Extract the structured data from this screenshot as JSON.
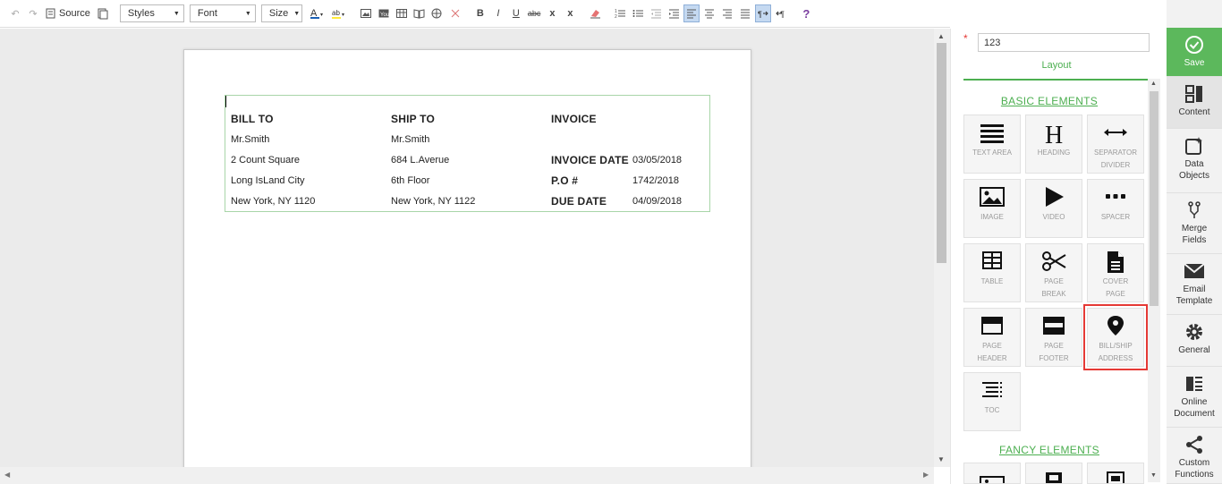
{
  "toolbar": {
    "source_label": "Source",
    "styles_label": "Styles",
    "font_label": "Font",
    "size_label": "Size",
    "bold": "B",
    "italic": "I",
    "underline": "U",
    "strike": "abc",
    "subscript": "x",
    "superscript": "x",
    "help": "?"
  },
  "invoice": {
    "bill_to": "BILL TO",
    "ship_to": "SHIP TO",
    "invoice": "INVOICE",
    "bill_name": "Mr.Smith",
    "ship_name": "Mr.Smith",
    "bill_addr1": "2 Count Square",
    "ship_addr1": "684 L.Averue",
    "invoice_date_label": "INVOICE DATE",
    "invoice_date": "03/05/2018",
    "bill_addr2": "Long IsLand City",
    "ship_addr2": "6th Floor",
    "po_label": "P.O #",
    "po_value": "1742/2018",
    "bill_addr3": "New York, NY 1120",
    "ship_addr3": "New York, NY 1122",
    "due_date_label": "DUE DATE",
    "due_date": "04/09/2018"
  },
  "panel": {
    "name_value": "123",
    "required_mark": "*",
    "tab_label": "Layout",
    "basic_title": "BASIC ELEMENTS",
    "fancy_title": "FANCY ELEMENTS",
    "tiles": [
      {
        "label1": "TEXT AREA",
        "label2": "",
        "icon": "text-area-icon"
      },
      {
        "label1": "HEADING",
        "label2": "",
        "icon": "heading-icon"
      },
      {
        "label1": "SEPARATOR",
        "label2": "DIVIDER",
        "icon": "separator-icon"
      },
      {
        "label1": "IMAGE",
        "label2": "",
        "icon": "image-icon"
      },
      {
        "label1": "VIDEO",
        "label2": "",
        "icon": "video-icon"
      },
      {
        "label1": "SPACER",
        "label2": "",
        "icon": "spacer-icon"
      },
      {
        "label1": "TABLE",
        "label2": "",
        "icon": "table-icon"
      },
      {
        "label1": "PAGE",
        "label2": "BREAK",
        "icon": "scissors-icon"
      },
      {
        "label1": "COVER",
        "label2": "PAGE",
        "icon": "cover-page-icon"
      },
      {
        "label1": "PAGE",
        "label2": "HEADER",
        "icon": "page-header-icon"
      },
      {
        "label1": "PAGE",
        "label2": "FOOTER",
        "icon": "page-footer-icon"
      },
      {
        "label1": "BILL/SHIP",
        "label2": "ADDRESS",
        "icon": "location-pin-icon"
      },
      {
        "label1": "TOC",
        "label2": "",
        "icon": "toc-icon"
      }
    ]
  },
  "sidebar": {
    "save": "Save",
    "content": "Content",
    "data_objects_1": "Data",
    "data_objects_2": "Objects",
    "merge_fields_1": "Merge",
    "merge_fields_2": "Fields",
    "email_template_1": "Email",
    "email_template_2": "Template",
    "general": "General",
    "online_document_1": "Online",
    "online_document_2": "Document",
    "custom_functions_1": "Custom",
    "custom_functions_2": "Functions"
  },
  "colors": {
    "accent": "#4caf50",
    "save_bg": "#5cb85c",
    "highlight": "#e53935"
  }
}
